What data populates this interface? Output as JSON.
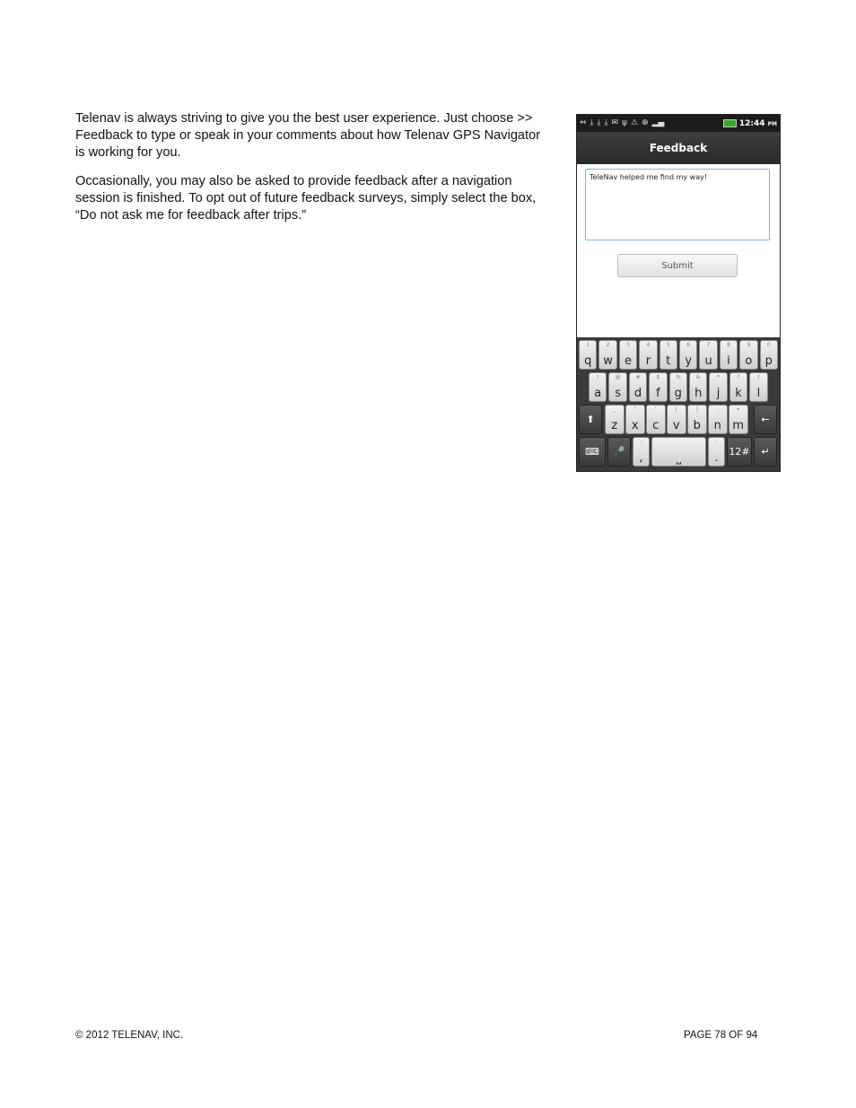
{
  "paragraphs": [
    "Telenav is always striving to give you the best user experience. Just choose >> Feedback to type or speak in your comments about how Telenav GPS Navigator is working for you.",
    "Occasionally, you may also be asked to provide feedback after a navigation session is finished. To opt out of future feedback surveys, simply select the box, “Do not ask me for feedback after trips.”"
  ],
  "footer": {
    "copyright": "© 2012 TELENAV, INC.",
    "page": "PAGE 78 OF 94"
  },
  "phone": {
    "status_icons": [
      "usb-icon",
      "download-icon",
      "download-icon",
      "download-icon",
      "mail-icon",
      "usb-debug-icon",
      "warning-icon",
      "gps-icon",
      "signal-icon",
      "battery-icon"
    ],
    "clock": "12:44",
    "clock_ampm": "PM",
    "title": "Feedback",
    "feedback_text": "TeleNav helped me find my way!",
    "submit_label": "Submit",
    "keyboard": {
      "row1": [
        {
          "alt": "1",
          "main": "q"
        },
        {
          "alt": "2",
          "main": "w"
        },
        {
          "alt": "3",
          "main": "e"
        },
        {
          "alt": "4",
          "main": "r"
        },
        {
          "alt": "5",
          "main": "t"
        },
        {
          "alt": "6",
          "main": "y"
        },
        {
          "alt": "7",
          "main": "u"
        },
        {
          "alt": "8",
          "main": "i"
        },
        {
          "alt": "9",
          "main": "o"
        },
        {
          "alt": "0",
          "main": "p"
        }
      ],
      "row2": [
        {
          "alt": "!",
          "main": "a"
        },
        {
          "alt": "@",
          "main": "s"
        },
        {
          "alt": "#",
          "main": "d"
        },
        {
          "alt": "$",
          "main": "f"
        },
        {
          "alt": "%",
          "main": "g"
        },
        {
          "alt": "&",
          "main": "h"
        },
        {
          "alt": "*",
          "main": "j"
        },
        {
          "alt": "?",
          "main": "k"
        },
        {
          "alt": "/",
          "main": "l"
        }
      ],
      "row3": [
        {
          "alt": "_",
          "main": "z"
        },
        {
          "alt": "\"",
          "main": "x"
        },
        {
          "alt": "'",
          "main": "c"
        },
        {
          "alt": "(",
          "main": "v"
        },
        {
          "alt": ")",
          "main": "b"
        },
        {
          "alt": "-",
          "main": "n"
        },
        {
          "alt": "+",
          "main": "m"
        }
      ],
      "shift": "⬆",
      "backspace": "←",
      "keyboard_switch": "⌨",
      "mic": "🎤",
      "comma_alt": ":",
      "comma": ",",
      "space": "⎵",
      "period_alt": ":",
      "period": ".",
      "symbols": "12#",
      "enter": "↵"
    }
  }
}
